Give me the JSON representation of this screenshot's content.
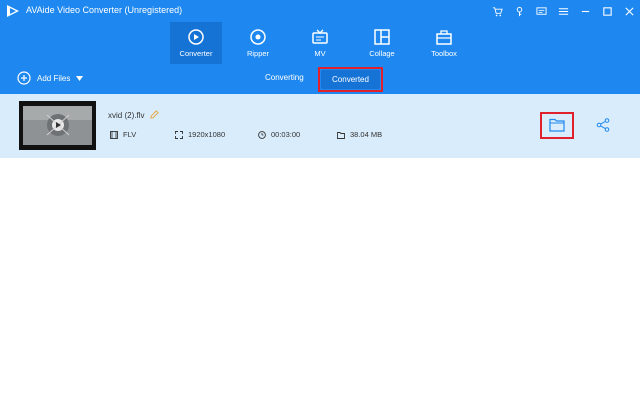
{
  "window": {
    "title": "AVAide Video Converter (Unregistered)"
  },
  "tabs": [
    {
      "label": "Converter",
      "icon": "converter-icon",
      "active": true
    },
    {
      "label": "Ripper",
      "icon": "ripper-icon",
      "active": false
    },
    {
      "label": "MV",
      "icon": "mv-icon",
      "active": false
    },
    {
      "label": "Collage",
      "icon": "collage-icon",
      "active": false
    },
    {
      "label": "Toolbox",
      "icon": "toolbox-icon",
      "active": false
    }
  ],
  "subbar": {
    "add_files_label": "Add Files",
    "segments": {
      "converting": "Converting",
      "converted": "Converted"
    }
  },
  "file": {
    "name": "xvid (2).flv",
    "format": "FLV",
    "resolution": "1920x1080",
    "duration": "00:03:00",
    "size": "38.04 MB"
  },
  "colors": {
    "accent": "#1e88f0",
    "accent_dark": "#1573d6",
    "row_bg": "#d9ecfb",
    "highlight": "#e0202a"
  }
}
